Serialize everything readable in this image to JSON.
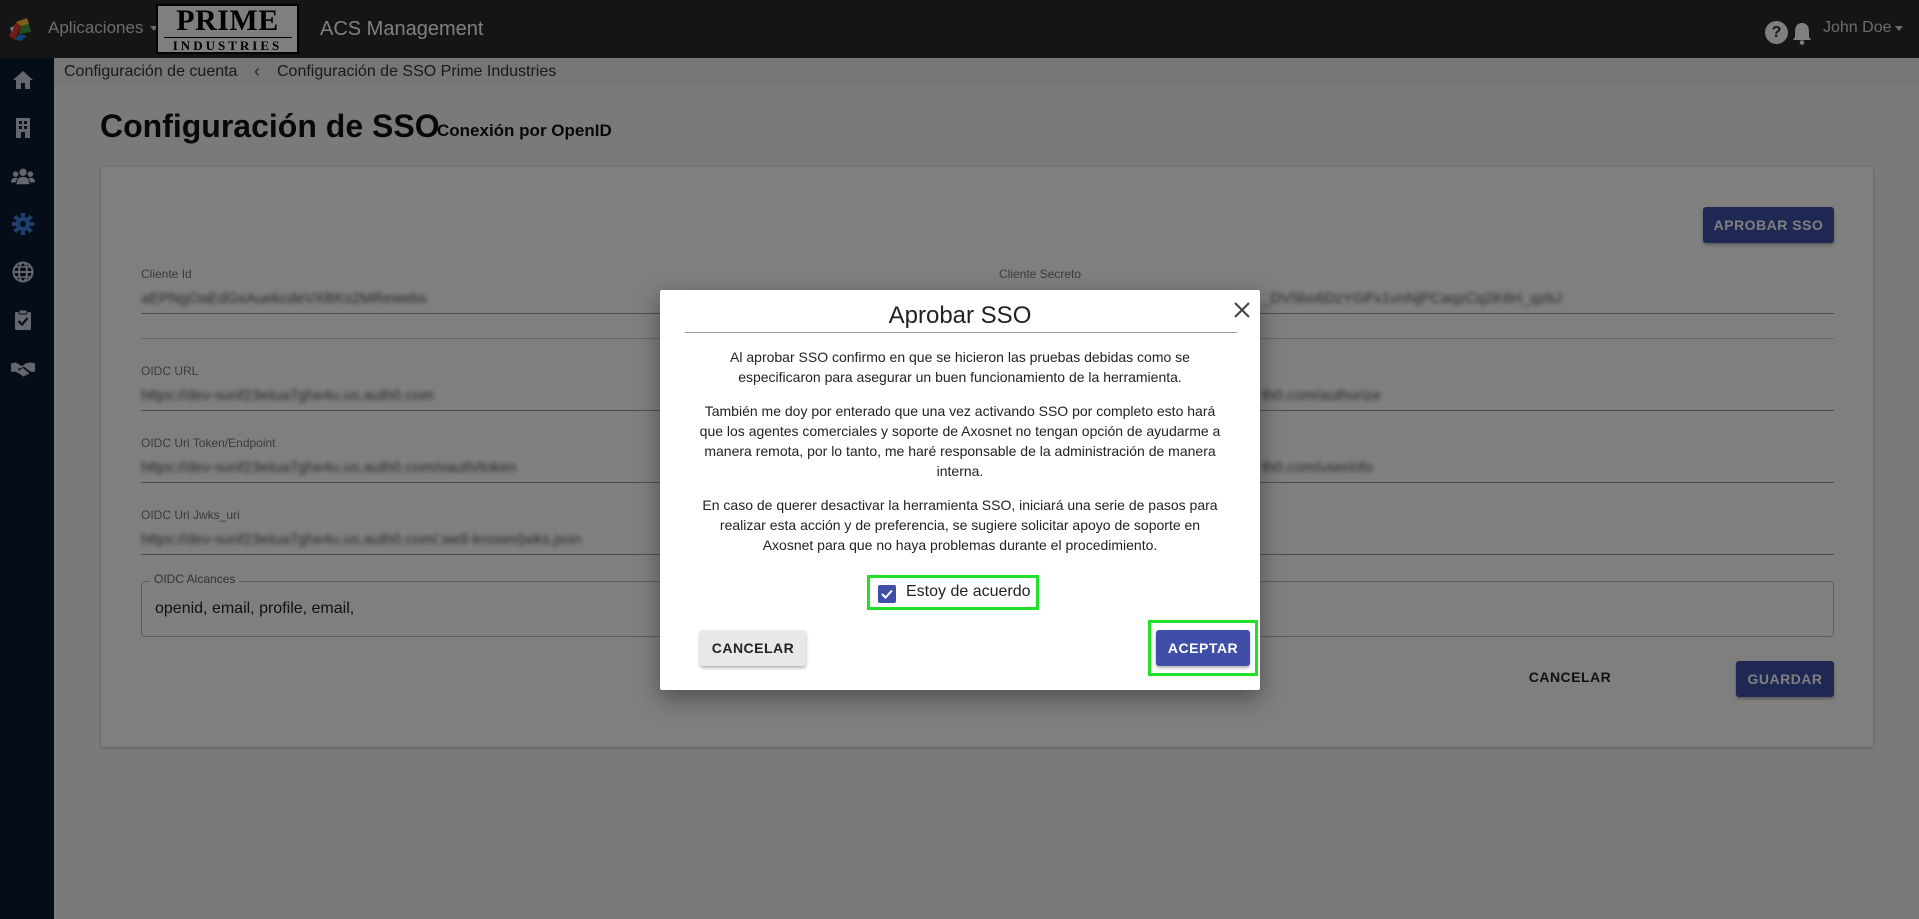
{
  "header": {
    "apps_menu_label": "Aplicaciones",
    "brand_top": "PRIME",
    "brand_bottom": "INDUSTRIES",
    "app_title": "ACS Management",
    "help_icon": "?",
    "user_name": "John Doe"
  },
  "sidebar": {
    "items": [
      {
        "icon": "home-icon"
      },
      {
        "icon": "building-icon"
      },
      {
        "icon": "users-icon"
      },
      {
        "icon": "gear-icon",
        "active": true
      },
      {
        "icon": "globe-icon"
      },
      {
        "icon": "clipboard-check-icon"
      },
      {
        "icon": "handshake-icon"
      }
    ]
  },
  "breadcrumb": {
    "parent": "Configuración de cuenta",
    "separator": "‹",
    "current": "Configuración de SSO Prime Industries"
  },
  "page": {
    "title": "Configuración de SSO",
    "subtitle": "Conexión por OpenID",
    "approve_button": "APROBAR SSO"
  },
  "form": {
    "client_id_label": "Cliente Id",
    "client_id_value": "aEPNgOaEdGxAuekcdeVXBKs2MRewebs",
    "client_secret_label": "Cliente Secreto",
    "client_secret_value": "_DV5bo6DzYGPx1vnNjPCaqzCq2K6H_qzbJ",
    "oidc_url_label": "OIDC URL",
    "oidc_url_value": "https://dev-sunf23etua7ghe4u.us.auth0.com",
    "oidc_authorize_value": "th0.com/authorize",
    "oidc_token_label": "OIDC Url Token/Endpoint",
    "oidc_token_value": "https://dev-sunf23etua7ghe4u.us.auth0.com/oauth/token",
    "oidc_userinfo_value": "th0.com/userinfo",
    "oidc_jwks_label": "OIDC Url Jwks_uri",
    "oidc_jwks_value": "https://dev-sunf23etua7ghe4u.us.auth0.com/.well-known/jwks.json",
    "scopes_label": "OIDC Alcances",
    "scopes_value": "openid, email, profile, email,",
    "cancel_button": "CANCELAR",
    "save_button": "GUARDAR"
  },
  "modal": {
    "title": "Aprobar SSO",
    "paragraph1": "Al aprobar SSO confirmo en que se hicieron las pruebas debidas como se especificaron para asegurar un buen funcionamiento de la herramienta.",
    "paragraph2": "También me doy por enterado que una vez activando SSO por completo esto hará que los agentes comerciales y soporte de Axosnet no tengan opción de ayudarme a manera remota, por lo tanto, me haré responsable de la administración de manera interna.",
    "paragraph3": "En caso de querer desactivar la herramienta SSO, iniciará una serie de pasos para realizar esta acción y de preferencia, se sugiere solicitar apoyo de soporte en Axosnet para que no haya problemas durante el procedimiento.",
    "agree_label": "Estoy de acuerdo",
    "agree_checked": true,
    "cancel_button": "CANCELAR",
    "accept_button": "ACEPTAR"
  },
  "colors": {
    "primary": "#3f4ea6",
    "sidebar_bg": "#0a1a33",
    "topbar_bg": "#2b2b2b",
    "highlight": "#22e02a"
  }
}
